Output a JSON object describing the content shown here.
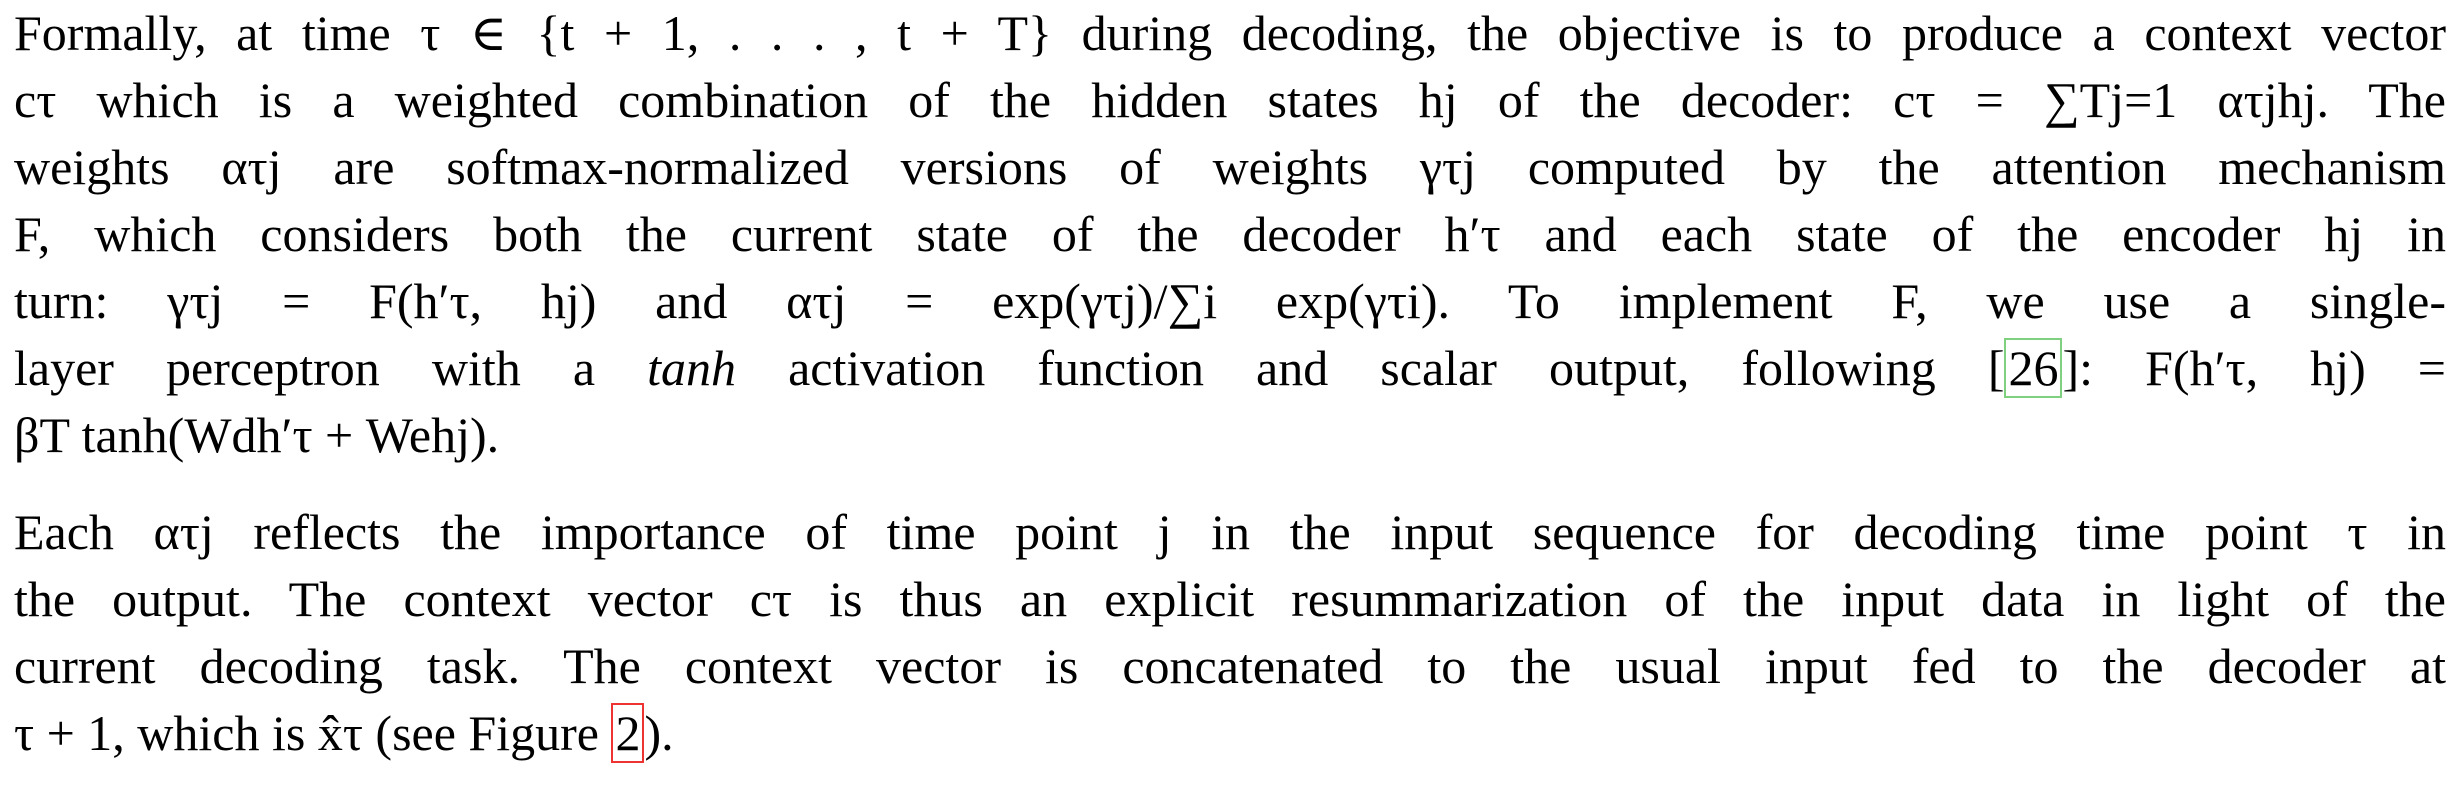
{
  "paragraphs": [
    {
      "lines": [
        "Formally, at time τ ∈ {t + 1, . . . , t + T} during decoding, the objective is to produce a context vector",
        "cτ which is a weighted combination of the hidden states hj of the decoder: cτ = ∑Tj=1 ατjhj. The",
        "weights ατj are softmax-normalized versions of weights γτj computed by the attention mechanism",
        "F, which considers both the current state of the decoder h′τ and each state of the encoder hj in",
        "turn: γτj = F(h′τ, hj) and ατj = exp(γτj)/∑i exp(γτi). To implement F, we use a single-",
        {
          "pre": "layer perceptron with a ",
          "em": "tanh",
          "mid": " activation function and scalar output, following [",
          "ref": "26",
          "post": "]: F(h′τ, hj) ="
        },
        "βT tanh(Wdh′τ + Wehj)."
      ]
    },
    {
      "lines": [
        "Each ατj reflects the importance of time point j in the input sequence for decoding time point τ in",
        "the output. The context vector cτ is thus an explicit resummarization of the input data in light of the",
        "current decoding task. The context vector is concatenated to the usual input fed to the decoder at",
        {
          "pre": "τ + 1, which is x̂τ (see Figure ",
          "ref": "2",
          "post": ")."
        }
      ]
    }
  ],
  "colors": {
    "text": "#000000",
    "citation_box": "#7fd07f",
    "figure_ref_box": "#ee3333"
  }
}
